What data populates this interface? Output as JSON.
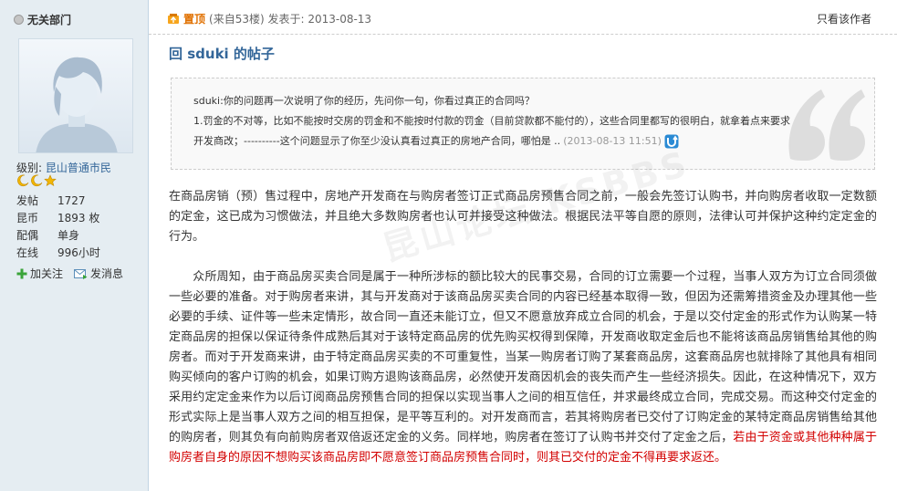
{
  "user": {
    "name": "无关部门",
    "level_label": "级别:",
    "level_value": "昆山普通市民",
    "stats": [
      {
        "key": "发帖",
        "value": "1727"
      },
      {
        "key": "昆币",
        "value": "1893 枚"
      },
      {
        "key": "配偶",
        "value": "单身"
      },
      {
        "key": "在线",
        "value": "996小时"
      }
    ],
    "actions": {
      "follow": "加关注",
      "message": "发消息"
    }
  },
  "post": {
    "sticky_label": "置顶",
    "meta": "(来自53楼) 发表于: 2013-08-13",
    "only_author": "只看该作者",
    "title": "回 sduki 的帖子",
    "quote": {
      "line1": "sduki:你的问题再一次说明了你的经历，先问你一句，你看过真正的合同吗？",
      "line2": "1.罚金的不对等，比如不能按时交房的罚金和不能按时付款的罚金（目前贷款都不能付的），这些合同里都写的很明白，就拿着点来要求",
      "line3": "开发商改；----------这个问题显示了你至少没认真看过真正的房地产合同，哪怕是 ..",
      "date": "(2013-08-13 11:51)"
    },
    "paragraph1": "在商品房销（预）售过程中，房地产开发商在与购房者签订正式商品房预售合同之前，一般会先签订认购书，并向购房者收取一定数额的定金，这已成为习惯做法，并且绝大多数购房者也认可并接受这种做法。根据民法平等自愿的原则，法律认可并保护这种约定定金的行为。",
    "paragraph2": "　　众所周知，由于商品房买卖合同是属于一种所涉标的额比较大的民事交易，合同的订立需要一个过程，当事人双方为订立合同须做一些必要的准备。对于购房者来讲，其与开发商对于该商品房买卖合同的内容已经基本取得一致，但因为还需筹措资金及办理其他一些必要的手续、证件等一些未定情形，故合同一直还未能订立，但又不愿意放弃成立合同的机会，于是以交付定金的形式作为认购某一特定商品房的担保以保证待条件成熟后其对于该特定商品房的优先购买权得到保障，开发商收取定金后也不能将该商品房销售给其他的购房者。而对于开发商来讲，由于特定商品房买卖的不可重复性，当某一购房者订购了某套商品房，这套商品房也就排除了其他具有相同购买倾向的客户订购的机会，如果订购方退购该商品房，必然使开发商因机会的丧失而产生一些经济损失。因此，在这种情况下，双方采用约定定金来作为以后订阅商品房预售合同的担保以实现当事人之间的相互信任，并求最终成立合同，完成交易。而这种交付定金的形式实际上是当事人双方之间的相互担保，是平等互利的。对开发商而言，若其将购房者已交付了订购定金的某特定商品房销售给其他的购房者，则其负有向前购房者双倍返还定金的义务。同样地，购房者在签订了认购书并交付了定金之后，",
    "paragraph2_red": "若由于资金或其他种种属于购房者自身的原因不想购买该商品房即不愿意签订商品房预售合同时，则其已交付的定金不得再要求返还。",
    "watermark": "昆山论坛 KSBBS"
  },
  "colors": {
    "accent": "#336699",
    "sidebar_bg": "#e5edf2",
    "red_text": "#d20000",
    "sticky": "#e07000"
  }
}
